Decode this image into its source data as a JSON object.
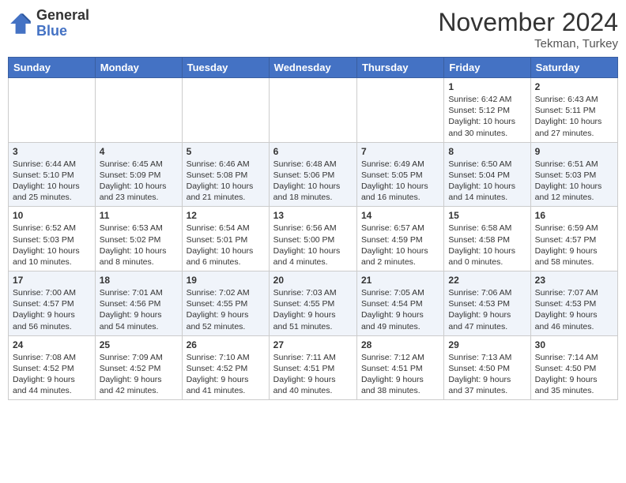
{
  "header": {
    "logo_general": "General",
    "logo_blue": "Blue",
    "month": "November 2024",
    "location": "Tekman, Turkey"
  },
  "weekdays": [
    "Sunday",
    "Monday",
    "Tuesday",
    "Wednesday",
    "Thursday",
    "Friday",
    "Saturday"
  ],
  "weeks": [
    [
      {
        "day": "",
        "info": ""
      },
      {
        "day": "",
        "info": ""
      },
      {
        "day": "",
        "info": ""
      },
      {
        "day": "",
        "info": ""
      },
      {
        "day": "",
        "info": ""
      },
      {
        "day": "1",
        "info": "Sunrise: 6:42 AM\nSunset: 5:12 PM\nDaylight: 10 hours\nand 30 minutes."
      },
      {
        "day": "2",
        "info": "Sunrise: 6:43 AM\nSunset: 5:11 PM\nDaylight: 10 hours\nand 27 minutes."
      }
    ],
    [
      {
        "day": "3",
        "info": "Sunrise: 6:44 AM\nSunset: 5:10 PM\nDaylight: 10 hours\nand 25 minutes."
      },
      {
        "day": "4",
        "info": "Sunrise: 6:45 AM\nSunset: 5:09 PM\nDaylight: 10 hours\nand 23 minutes."
      },
      {
        "day": "5",
        "info": "Sunrise: 6:46 AM\nSunset: 5:08 PM\nDaylight: 10 hours\nand 21 minutes."
      },
      {
        "day": "6",
        "info": "Sunrise: 6:48 AM\nSunset: 5:06 PM\nDaylight: 10 hours\nand 18 minutes."
      },
      {
        "day": "7",
        "info": "Sunrise: 6:49 AM\nSunset: 5:05 PM\nDaylight: 10 hours\nand 16 minutes."
      },
      {
        "day": "8",
        "info": "Sunrise: 6:50 AM\nSunset: 5:04 PM\nDaylight: 10 hours\nand 14 minutes."
      },
      {
        "day": "9",
        "info": "Sunrise: 6:51 AM\nSunset: 5:03 PM\nDaylight: 10 hours\nand 12 minutes."
      }
    ],
    [
      {
        "day": "10",
        "info": "Sunrise: 6:52 AM\nSunset: 5:03 PM\nDaylight: 10 hours\nand 10 minutes."
      },
      {
        "day": "11",
        "info": "Sunrise: 6:53 AM\nSunset: 5:02 PM\nDaylight: 10 hours\nand 8 minutes."
      },
      {
        "day": "12",
        "info": "Sunrise: 6:54 AM\nSunset: 5:01 PM\nDaylight: 10 hours\nand 6 minutes."
      },
      {
        "day": "13",
        "info": "Sunrise: 6:56 AM\nSunset: 5:00 PM\nDaylight: 10 hours\nand 4 minutes."
      },
      {
        "day": "14",
        "info": "Sunrise: 6:57 AM\nSunset: 4:59 PM\nDaylight: 10 hours\nand 2 minutes."
      },
      {
        "day": "15",
        "info": "Sunrise: 6:58 AM\nSunset: 4:58 PM\nDaylight: 10 hours\nand 0 minutes."
      },
      {
        "day": "16",
        "info": "Sunrise: 6:59 AM\nSunset: 4:57 PM\nDaylight: 9 hours\nand 58 minutes."
      }
    ],
    [
      {
        "day": "17",
        "info": "Sunrise: 7:00 AM\nSunset: 4:57 PM\nDaylight: 9 hours\nand 56 minutes."
      },
      {
        "day": "18",
        "info": "Sunrise: 7:01 AM\nSunset: 4:56 PM\nDaylight: 9 hours\nand 54 minutes."
      },
      {
        "day": "19",
        "info": "Sunrise: 7:02 AM\nSunset: 4:55 PM\nDaylight: 9 hours\nand 52 minutes."
      },
      {
        "day": "20",
        "info": "Sunrise: 7:03 AM\nSunset: 4:55 PM\nDaylight: 9 hours\nand 51 minutes."
      },
      {
        "day": "21",
        "info": "Sunrise: 7:05 AM\nSunset: 4:54 PM\nDaylight: 9 hours\nand 49 minutes."
      },
      {
        "day": "22",
        "info": "Sunrise: 7:06 AM\nSunset: 4:53 PM\nDaylight: 9 hours\nand 47 minutes."
      },
      {
        "day": "23",
        "info": "Sunrise: 7:07 AM\nSunset: 4:53 PM\nDaylight: 9 hours\nand 46 minutes."
      }
    ],
    [
      {
        "day": "24",
        "info": "Sunrise: 7:08 AM\nSunset: 4:52 PM\nDaylight: 9 hours\nand 44 minutes."
      },
      {
        "day": "25",
        "info": "Sunrise: 7:09 AM\nSunset: 4:52 PM\nDaylight: 9 hours\nand 42 minutes."
      },
      {
        "day": "26",
        "info": "Sunrise: 7:10 AM\nSunset: 4:52 PM\nDaylight: 9 hours\nand 41 minutes."
      },
      {
        "day": "27",
        "info": "Sunrise: 7:11 AM\nSunset: 4:51 PM\nDaylight: 9 hours\nand 40 minutes."
      },
      {
        "day": "28",
        "info": "Sunrise: 7:12 AM\nSunset: 4:51 PM\nDaylight: 9 hours\nand 38 minutes."
      },
      {
        "day": "29",
        "info": "Sunrise: 7:13 AM\nSunset: 4:50 PM\nDaylight: 9 hours\nand 37 minutes."
      },
      {
        "day": "30",
        "info": "Sunrise: 7:14 AM\nSunset: 4:50 PM\nDaylight: 9 hours\nand 35 minutes."
      }
    ]
  ]
}
